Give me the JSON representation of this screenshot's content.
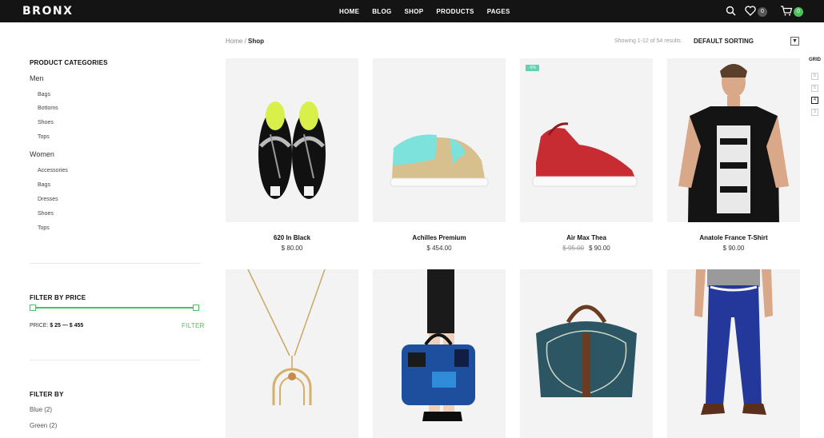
{
  "brand": "BRONX",
  "nav": [
    "HOME",
    "BLOG",
    "SHOP",
    "PRODUCTS",
    "PAGES"
  ],
  "header": {
    "wishlist_count": "0",
    "cart_count": "0",
    "badge_color": "#4bc25b"
  },
  "breadcrumb": {
    "home": "Home",
    "sep": " / ",
    "current": "Shop"
  },
  "results": {
    "showing": "Showing 1-12 of 54 results",
    "sorting": "DEFAULT SORTING"
  },
  "grid": {
    "label": "GRID",
    "options": [
      "6",
      "5",
      "4",
      "3"
    ],
    "selected": "4"
  },
  "sidebar": {
    "categories_title": "PRODUCT CATEGORIES",
    "categories": [
      {
        "label": "Men",
        "items": [
          "Bags",
          "Bottoms",
          "Shoes",
          "Tops"
        ]
      },
      {
        "label": "Women",
        "items": [
          "Accessories",
          "Bags",
          "Dresses",
          "Shoes",
          "Tops"
        ]
      }
    ],
    "price_title": "FILTER BY PRICE",
    "price_label": "PRICE:",
    "price_range": "$ 25 — $ 455",
    "filter_button": "FILTER",
    "filter_by_title": "FILTER BY",
    "colors": [
      "Blue (2)",
      "Green (2)"
    ]
  },
  "products": [
    {
      "name": "620 In Black",
      "price": "$ 80.00",
      "old_price": ""
    },
    {
      "name": "Achilles Premium",
      "price": "$ 454.00",
      "old_price": ""
    },
    {
      "name": "Air Max Thea",
      "price": "$ 90.00",
      "old_price": "$ 95.00",
      "sale": "-5%"
    },
    {
      "name": "Anatole France T-Shirt",
      "price": "$ 90.00",
      "old_price": ""
    },
    {
      "name": "",
      "price": "",
      "old_price": ""
    },
    {
      "name": "",
      "price": "",
      "old_price": ""
    },
    {
      "name": "",
      "price": "",
      "old_price": ""
    },
    {
      "name": "",
      "price": "",
      "old_price": ""
    }
  ]
}
